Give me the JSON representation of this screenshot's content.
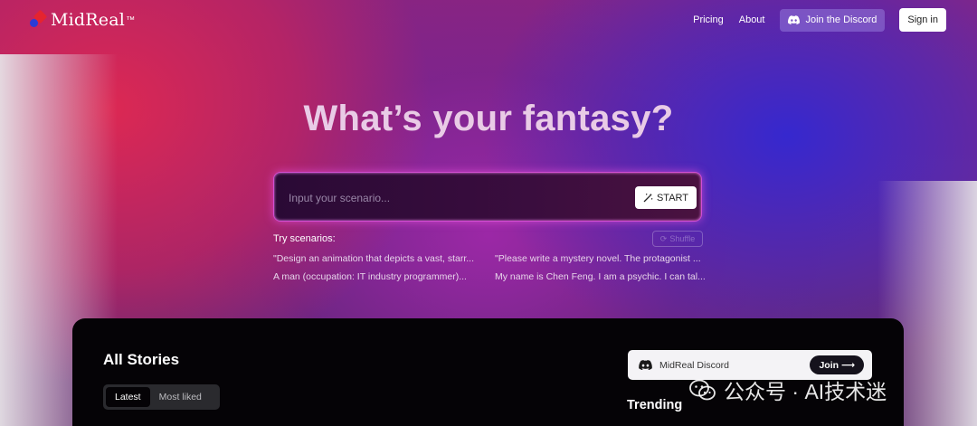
{
  "brand": {
    "name": "MidReal",
    "superscript": "™"
  },
  "nav": {
    "pricing": "Pricing",
    "about": "About",
    "discord": "Join the Discord",
    "signin": "Sign in"
  },
  "hero": {
    "title": "What’s your fantasy?",
    "input_placeholder": "Input your scenario...",
    "input_value": "",
    "start_label": "START",
    "try_label": "Try scenarios:",
    "shuffle_label": "Shuffle",
    "scenarios": [
      "\"Design an animation that depicts a vast, starr...",
      "\"Please write a mystery novel. The protagonist ...",
      "A man (occupation: IT industry programmer)...",
      "My name is Chen Feng. I am a psychic. I can tal..."
    ]
  },
  "stories": {
    "title": "All Stories",
    "tabs": [
      "Latest",
      "Most liked"
    ],
    "active_tab": "Latest"
  },
  "sidebar": {
    "discord_card_label": "MidReal Discord",
    "join_label": "Join ⟶",
    "trending_title": "Trending"
  },
  "watermark": {
    "text": "公众号 · AI技术迷"
  },
  "colors": {
    "accent_glow": "#d24fd2",
    "panel_bg": "#050306",
    "logo_red": "#e52430",
    "logo_blue": "#2b3bd6"
  },
  "icons": [
    "discord-icon",
    "magic-wand-icon",
    "shuffle-icon",
    "wechat-icon"
  ]
}
